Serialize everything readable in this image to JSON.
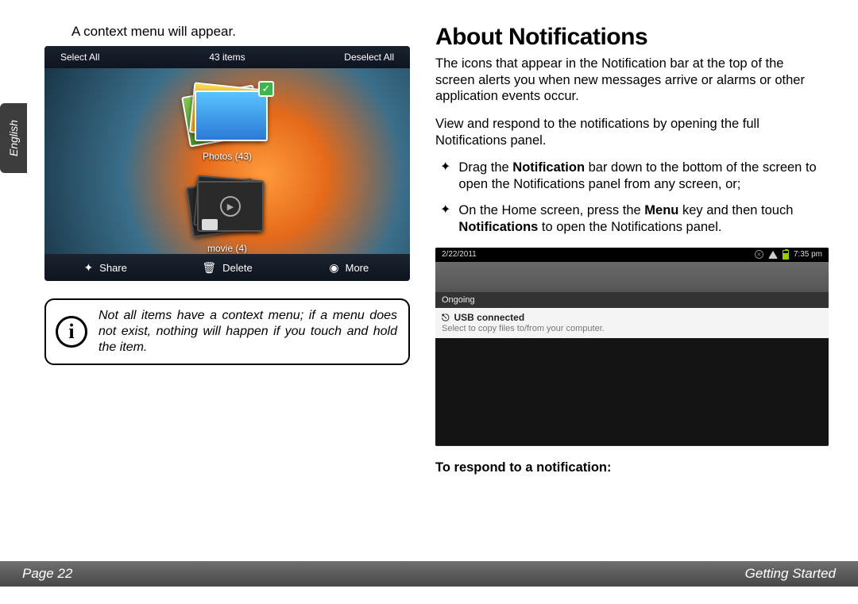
{
  "lang_tab": "English",
  "left": {
    "caption": "A context menu will appear.",
    "shot1": {
      "top": {
        "select_all": "Select All",
        "count": "43 items",
        "deselect_all": "Deselect All"
      },
      "photos_label": "Photos  (43)",
      "movie_label": "movie  (4)",
      "bottom": {
        "share": "Share",
        "delete": "Delete",
        "more": "More"
      }
    },
    "note": "Not all items have a context menu; if a menu does not exist, nothing will happen if you touch and hold the item."
  },
  "right": {
    "heading": "About Notifications",
    "p1": "The icons that appear in the Notification bar at the top of the screen alerts you when new messages arrive or alarms or other application events occur.",
    "p2": "View and respond to the notifications by opening the full Notifications panel.",
    "b1_pre": "Drag the ",
    "b1_bold": "Notification",
    "b1_post": " bar down to the bottom of the screen to open the Notifications panel from any screen, or;",
    "b2_pre": "On the Home screen, press the ",
    "b2_bold1": "Menu",
    "b2_mid": " key and then touch ",
    "b2_bold2": "Notifications",
    "b2_post": " to open the Notifications panel.",
    "shot2": {
      "date": "2/22/2011",
      "time": "7:35 pm",
      "ongoing": "Ongoing",
      "notif_title": "USB connected",
      "notif_sub": "Select to copy files to/from your computer."
    },
    "subhead": "To respond to a notification:"
  },
  "footer": {
    "page": "Page 22",
    "section": "Getting Started"
  }
}
